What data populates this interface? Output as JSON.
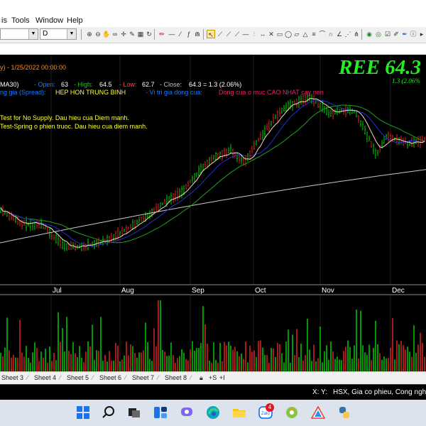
{
  "menu": {
    "items": [
      "is",
      "Tools",
      "Window",
      "Help"
    ]
  },
  "toolbar": {
    "symbol_value": "",
    "period_value": "D"
  },
  "chart": {
    "title_left": "y) - 1/25/2022 00:00:00",
    "ticker": "REE 64.3",
    "ticker_change": "1.3 (2.06%",
    "indicator_label": "MA30)",
    "ohlc": {
      "open_label": "- Open:",
      "open": "63",
      "high_label": "- High:",
      "high": "64.5",
      "low_label": "- Low:",
      "low": "62.7",
      "close_label": "- Close:",
      "close": "64.3 = 1.3 (2.06%)"
    },
    "spread_label": "ng gia (Spread):",
    "spread_value": "HEP HON TRUNG BINH",
    "position_label": "- Vi tri gia dong cua:",
    "position_value": "Dong cua o muc CAO NHAT cay nen",
    "signal_1": "Test for No Supply. Dau hieu cua Diem manh.",
    "signal_2": "Test-Spring o phien truoc. Dau hieu cua diem manh.",
    "months": [
      "Jul",
      "Aug",
      "Sep",
      "Oct",
      "Nov",
      "Dec"
    ],
    "colors": {
      "up": "#00cc00",
      "down": "#dd2222",
      "ma_fast": "#f0d8c8",
      "ma_mid": "#2030d0",
      "ma_slow": "#20a020",
      "ma_long": "#c8c8c8",
      "ticker": "#22ee22"
    }
  },
  "sheets": [
    "Sheet 3",
    "Sheet 4",
    "Sheet 5",
    "Sheet 6",
    "Sheet 7",
    "Sheet 8"
  ],
  "sheet_nav": [
    "+S",
    "+I"
  ],
  "status": {
    "coords": "X: Y:",
    "info": "HSX, Gia co phieu, Cong nghie"
  },
  "taskbar": {
    "icons": [
      "windows-start-icon",
      "search-icon",
      "task-view-icon",
      "widgets-icon",
      "chat-icon",
      "edge-icon",
      "file-explorer-icon",
      "zalo-icon",
      "app-icon",
      "amibroker-icon",
      "python-icon"
    ],
    "zalo_badge": "4"
  }
}
